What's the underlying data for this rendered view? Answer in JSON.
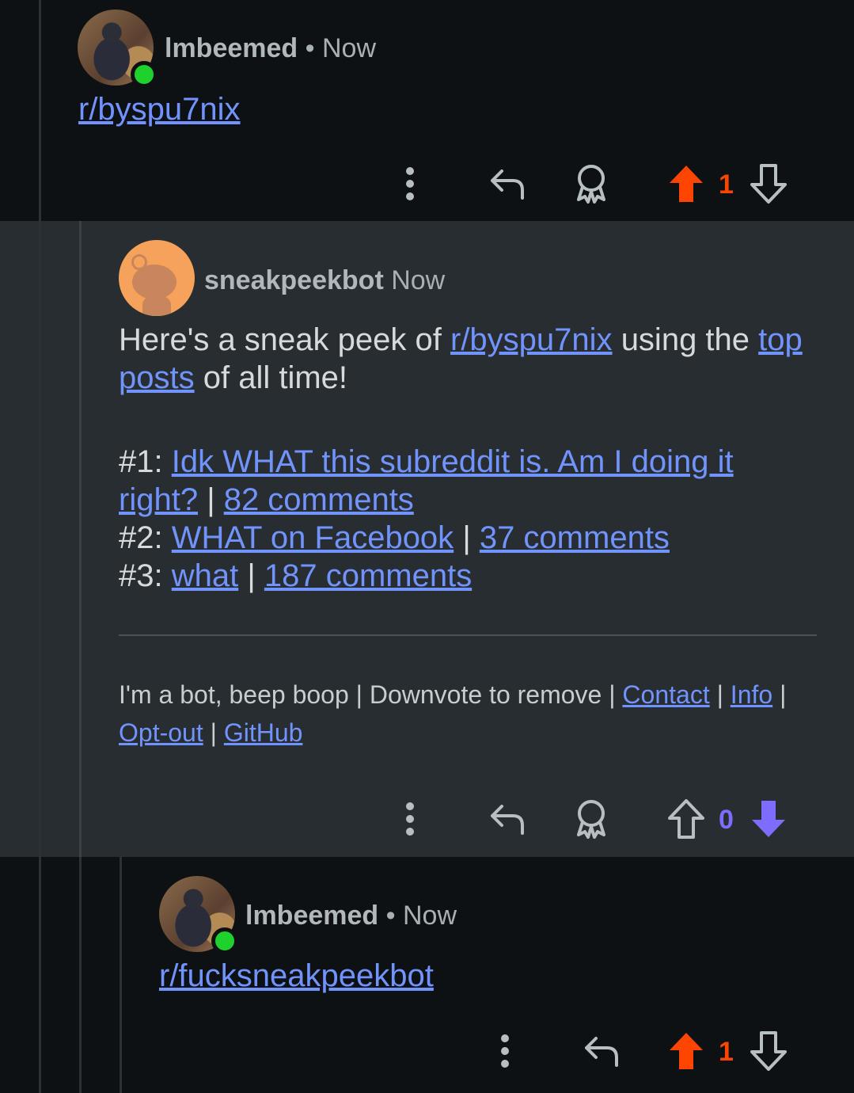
{
  "comments": [
    {
      "username": "lmbeemed",
      "separator": "•",
      "time": "Now",
      "link_text": "r/byspu7nix",
      "score": "1",
      "vote_state": "upvoted"
    },
    {
      "username": "sneakpeekbot",
      "time": "Now",
      "intro_prefix": "Here's a sneak peek of",
      "intro_link": "r/byspu7nix",
      "intro_middle": "using the",
      "intro_link2": "top posts",
      "intro_suffix": "of all time!",
      "posts": [
        {
          "rank": "#1:",
          "title": "Idk WHAT this subreddit is. Am I doing it right?",
          "comments": "82 comments"
        },
        {
          "rank": "#2:",
          "title": "WHAT on Facebook",
          "comments": "37 comments"
        },
        {
          "rank": "#3:",
          "title": "what",
          "comments": "187 comments"
        }
      ],
      "pipe": "|",
      "footer": {
        "prefix": "I'm a bot, beep boop | Downvote to remove |",
        "contact": "Contact",
        "info": "Info",
        "optout": "Opt-out",
        "github": "GitHub"
      },
      "score": "0",
      "vote_state": "downvoted"
    },
    {
      "username": "lmbeemed",
      "separator": "•",
      "time": "Now",
      "link_text": "r/fucksneakpeekbot",
      "score": "1",
      "vote_state": "upvoted"
    }
  ],
  "colors": {
    "upvote": "#ff4500",
    "downvote": "#7c6cff",
    "link": "#7193ff",
    "online": "#1fd12c"
  },
  "icons": [
    "more-vertical-icon",
    "reply-icon",
    "award-icon",
    "upvote-arrow-icon",
    "downvote-arrow-icon"
  ]
}
